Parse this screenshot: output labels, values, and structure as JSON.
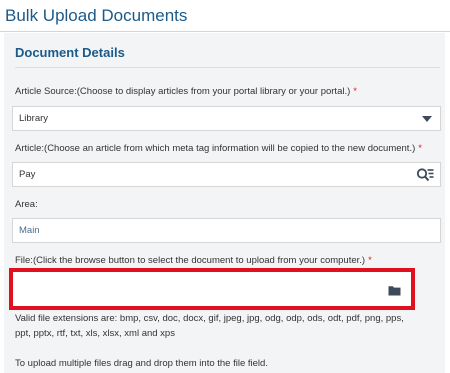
{
  "header": {
    "title": "Bulk Upload Documents"
  },
  "section": {
    "title": "Document Details"
  },
  "article_source": {
    "label": "Article Source:(Choose to display articles from your portal library or your portal.)",
    "required": "*",
    "value": "Library"
  },
  "article": {
    "label": "Article:(Choose an article from which meta tag information will be copied to the new document.)",
    "required": "*",
    "value": "Pay"
  },
  "area": {
    "label": "Area:",
    "value": "Main"
  },
  "file": {
    "label": "File:(Click the browse button to select the document to upload from your computer.)",
    "required": "*",
    "value": ""
  },
  "help": {
    "extensions_line1": "Valid file extensions are: bmp, csv, doc, docx, gif, jpeg, jpg, odg, odp, ods, odt, pdf, png, pps,",
    "extensions_line2": "ppt, pptx, rtf, txt, xls, xlsx, xml and xps",
    "drag_drop": "To upload multiple files drag and drop them into the file field."
  },
  "icons": {
    "article_lookup": "search-list-icon",
    "file_browse": "folder-icon",
    "source_dropdown": "caret-down-icon"
  },
  "colors": {
    "accent": "#1c5a8a",
    "required": "#e01b24",
    "highlight_border": "#e0101e",
    "panel_bg": "#f3f4f6"
  }
}
